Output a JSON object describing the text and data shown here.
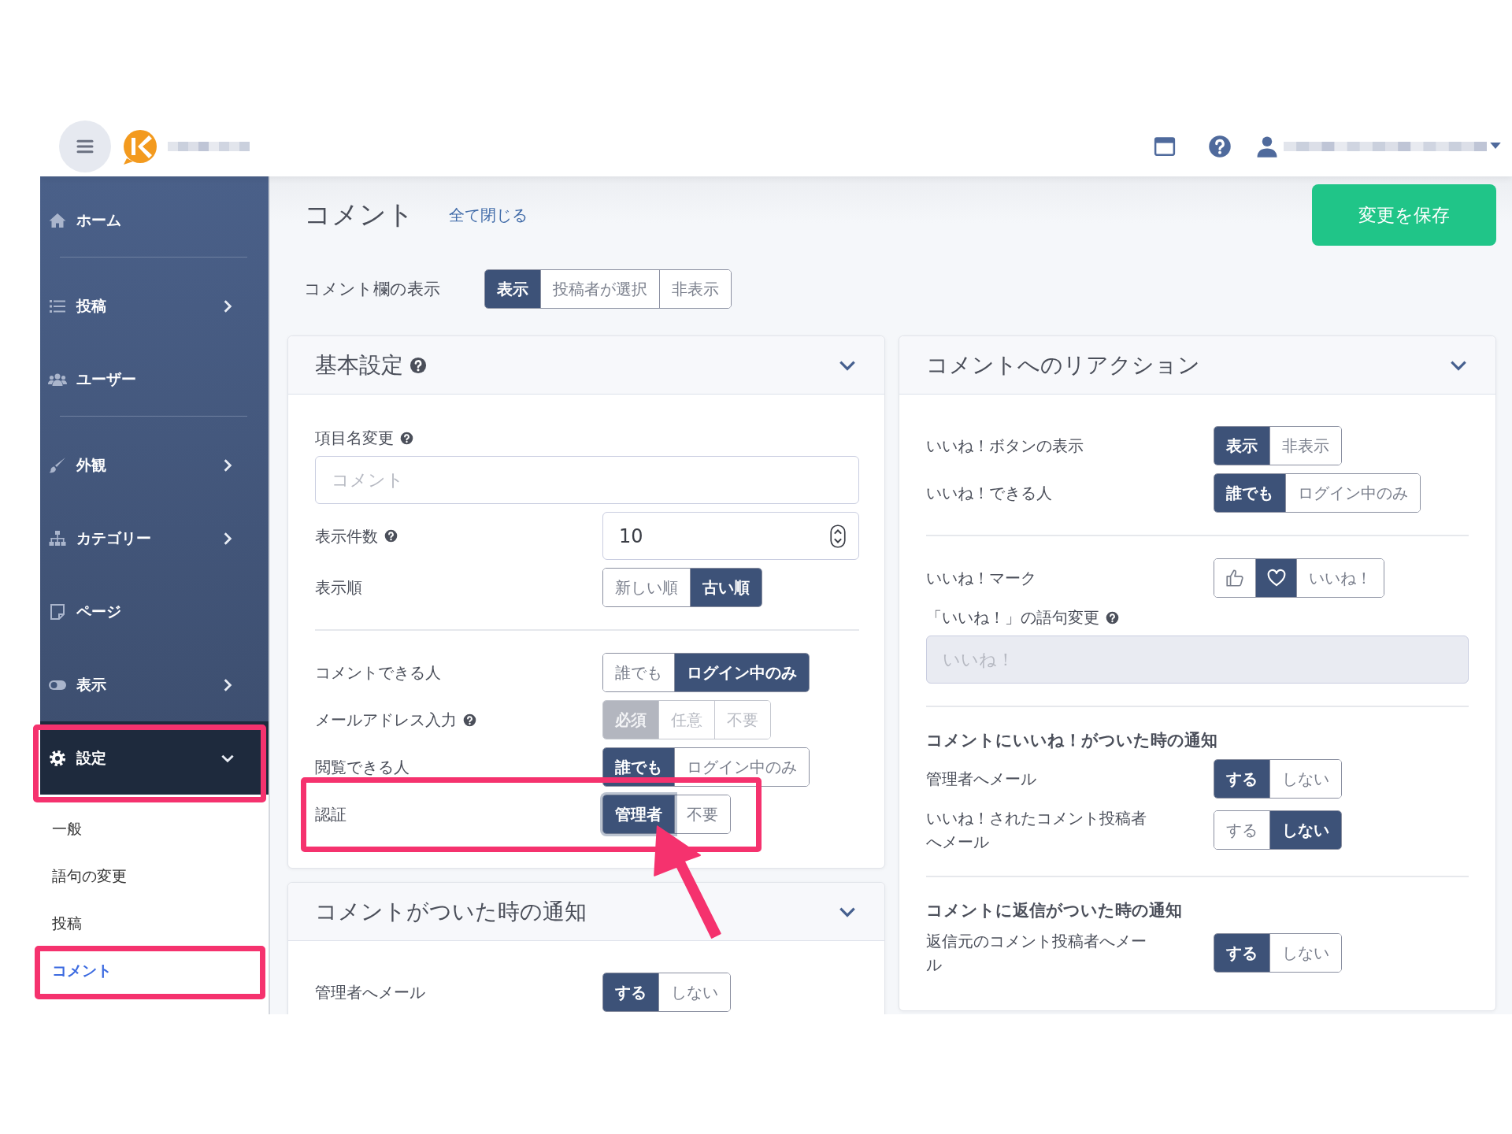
{
  "sidebar": {
    "groups": [
      [
        {
          "label": "ホーム",
          "submenu": false,
          "selected": false
        }
      ],
      [
        {
          "label": "投稿",
          "submenu": true,
          "selected": false
        },
        {
          "label": "ユーザー",
          "submenu": false,
          "selected": false
        }
      ],
      [
        {
          "label": "外観",
          "submenu": true,
          "selected": false
        },
        {
          "label": "カテゴリー",
          "submenu": true,
          "selected": false
        },
        {
          "label": "ページ",
          "submenu": false,
          "selected": false
        },
        {
          "label": "表示",
          "submenu": true,
          "selected": false
        },
        {
          "label": "設定",
          "submenu": true,
          "expanded": true,
          "selected": true,
          "children": [
            {
              "label": "一般",
              "selected": false
            },
            {
              "label": "語句の変更",
              "selected": false
            },
            {
              "label": "投稿",
              "selected": false
            },
            {
              "label": "コメント",
              "selected": true
            }
          ]
        }
      ]
    ]
  },
  "page": {
    "title": "コメント",
    "collapse_all_link": "全て閉じる",
    "save_button": "変更を保存",
    "display_setting": {
      "label": "コメント欄の表示",
      "options": [
        {
          "label": "表示",
          "selected": true
        },
        {
          "label": "投稿者が選択",
          "selected": false
        },
        {
          "label": "非表示",
          "selected": false
        }
      ]
    }
  },
  "panels": {
    "left": [
      {
        "title": "基本設定",
        "help": true,
        "expanded": true,
        "rows": [
          {
            "kind": "text_field",
            "label": "項目名変更",
            "help": true,
            "placeholder": "コメント",
            "disabled": false
          },
          {
            "kind": "number_field",
            "label": "表示件数",
            "help": true,
            "value": "10"
          },
          {
            "kind": "choice",
            "label": "表示順",
            "help": false,
            "options": [
              {
                "label": "新しい順",
                "selected": false
              },
              {
                "label": "古い順",
                "selected": true
              }
            ]
          },
          {
            "kind": "divider"
          },
          {
            "kind": "choice",
            "label": "コメントできる人",
            "help": false,
            "options": [
              {
                "label": "誰でも",
                "selected": false
              },
              {
                "label": "ログイン中のみ",
                "selected": true
              }
            ]
          },
          {
            "kind": "choice",
            "label": "メールアドレス入力",
            "help": true,
            "disabled": true,
            "options": [
              {
                "label": "必須",
                "selected": true
              },
              {
                "label": "任意",
                "selected": false
              },
              {
                "label": "不要",
                "selected": false
              }
            ]
          },
          {
            "kind": "choice",
            "label": "閲覧できる人",
            "help": false,
            "options": [
              {
                "label": "誰でも",
                "selected": true
              },
              {
                "label": "ログイン中のみ",
                "selected": false
              }
            ]
          },
          {
            "kind": "choice",
            "label": "認証",
            "help": false,
            "options": [
              {
                "label": "管理者",
                "selected": true,
                "focused": true
              },
              {
                "label": "不要",
                "selected": false,
                "focused": false
              }
            ]
          }
        ]
      },
      {
        "title": "コメントがついた時の通知",
        "help": false,
        "expanded": true,
        "rows": [
          {
            "kind": "choice",
            "label": "管理者へメール",
            "help": false,
            "options": [
              {
                "label": "する",
                "selected": true
              },
              {
                "label": "しない",
                "selected": false
              }
            ]
          }
        ]
      }
    ],
    "right": [
      {
        "title": "コメントへのリアクション",
        "help": false,
        "expanded": true,
        "rows": [
          {
            "kind": "choice",
            "label": "いいね！ボタンの表示",
            "help": false,
            "options": [
              {
                "label": "表示",
                "selected": true
              },
              {
                "label": "非表示",
                "selected": false
              }
            ]
          },
          {
            "kind": "choice",
            "label": "いいね！できる人",
            "help": false,
            "options": [
              {
                "label": "誰でも",
                "selected": true
              },
              {
                "label": "ログイン中のみ",
                "selected": false
              }
            ]
          },
          {
            "kind": "divider"
          },
          {
            "kind": "choice",
            "label": "いいね！マーク",
            "help": false,
            "options": [
              {
                "kind": "icon",
                "selected": false
              },
              {
                "kind": "icon",
                "selected": true
              },
              {
                "label": "いいね！",
                "selected": false
              }
            ]
          },
          {
            "kind": "text_field",
            "label": "「いいね！」の語句変更",
            "help": true,
            "placeholder": "いいね！",
            "disabled": true
          },
          {
            "kind": "divider"
          },
          {
            "kind": "heading",
            "text": "コメントにいいね！がついた時の通知"
          },
          {
            "kind": "choice",
            "label": "管理者へメール",
            "help": false,
            "options": [
              {
                "label": "する",
                "selected": true
              },
              {
                "label": "しない",
                "selected": false
              }
            ]
          },
          {
            "kind": "choice",
            "label": "いいね！されたコメント投稿者へメール",
            "help": false,
            "options": [
              {
                "label": "する",
                "selected": false
              },
              {
                "label": "しない",
                "selected": true
              }
            ]
          },
          {
            "kind": "divider"
          },
          {
            "kind": "heading",
            "text": "コメントに返信がついた時の通知"
          },
          {
            "kind": "choice",
            "label": "返信元のコメント投稿者へメール",
            "help": false,
            "options": [
              {
                "label": "する",
                "selected": true
              },
              {
                "label": "しない",
                "selected": false
              }
            ]
          }
        ]
      }
    ]
  }
}
